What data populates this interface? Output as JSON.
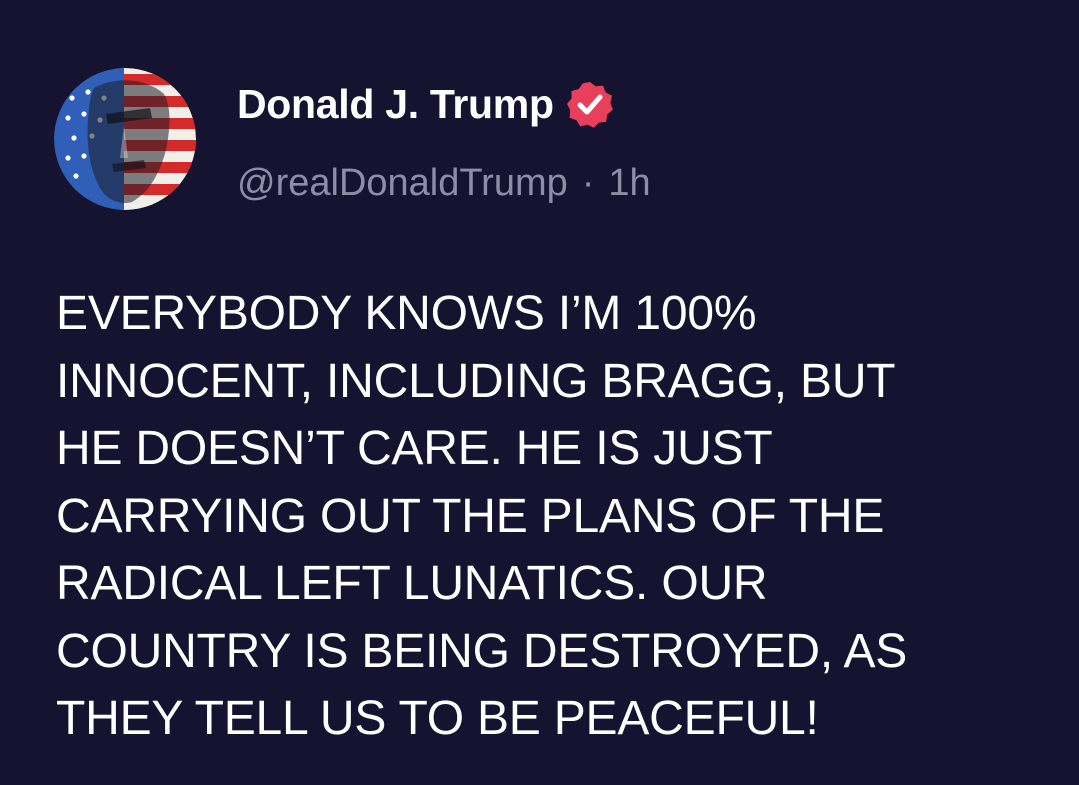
{
  "post": {
    "author": {
      "display_name": "Donald J. Trump",
      "verified": true,
      "verified_icon": "verified-badge-icon",
      "handle": "@realDonaldTrump",
      "separator": "·",
      "timestamp": "1h",
      "avatar": "flag-painted-portrait-avatar"
    },
    "body_lines": [
      "EVERYBODY KNOWS I’M 100%",
      "INNOCENT, INCLUDING BRAGG, BUT",
      "HE DOESN’T CARE. HE IS JUST",
      "CARRYING OUT THE PLANS OF THE",
      "RADICAL LEFT LUNATICS. OUR",
      "COUNTRY IS BEING DESTROYED, AS",
      "THEY TELL US TO BE PEACEFUL!"
    ]
  },
  "colors": {
    "background": "#15132f",
    "text_primary": "#ffffff",
    "text_secondary": "#8f8da6",
    "verified_badge": "#e83f5b"
  }
}
